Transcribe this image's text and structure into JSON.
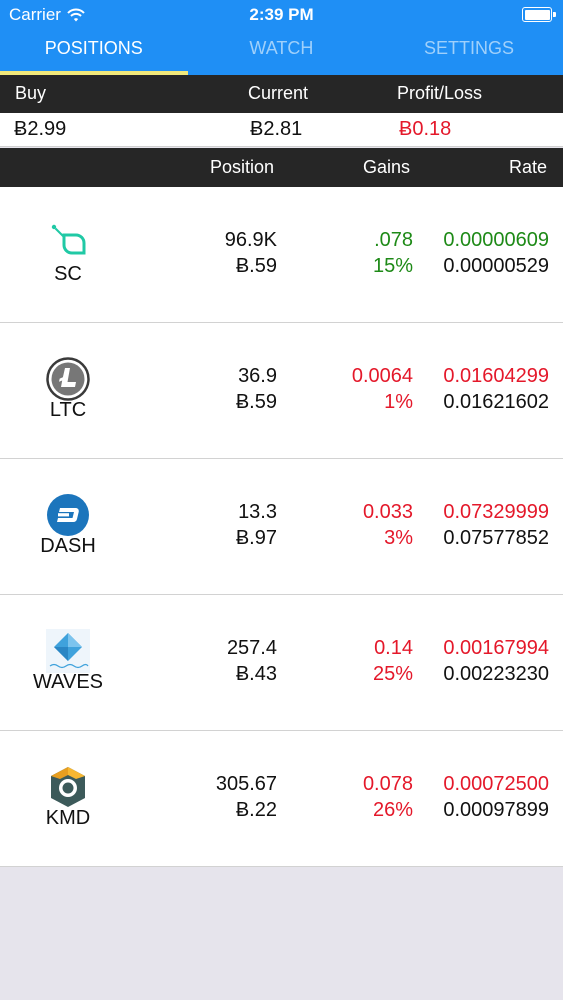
{
  "status_bar": {
    "carrier": "Carrier",
    "time": "2:39 PM",
    "wifi_icon": "wifi-icon",
    "battery_icon": "battery-icon"
  },
  "tabs": [
    {
      "label": "POSITIONS",
      "active": true
    },
    {
      "label": "WATCH",
      "active": false
    },
    {
      "label": "SETTINGS",
      "active": false
    }
  ],
  "summary": {
    "headers": {
      "buy": "Buy",
      "current": "Current",
      "profit_loss": "Profit/Loss"
    },
    "values": {
      "buy": "Ƀ2.99",
      "current": "Ƀ2.81",
      "profit_loss": "Ƀ0.18"
    }
  },
  "list_headers": {
    "position": "Position",
    "gains": "Gains",
    "rate": "Rate"
  },
  "colors": {
    "header_blue": "#1f8ff5",
    "tab_indicator": "#f1e87a",
    "gain": "#1e8a17",
    "loss": "#e4182a"
  },
  "coins": [
    {
      "symbol": "SC",
      "icon": "siacoin-icon",
      "position": "96.9K",
      "cost": "Ƀ.59",
      "gain": ".078",
      "gain_pct": "15%",
      "rate_current": "0.00000609",
      "rate_buy": "0.00000529",
      "trend": "gain"
    },
    {
      "symbol": "LTC",
      "icon": "litecoin-icon",
      "position": "36.9",
      "cost": "Ƀ.59",
      "gain": "0.0064",
      "gain_pct": "1%",
      "rate_current": "0.01604299",
      "rate_buy": "0.01621602",
      "trend": "loss"
    },
    {
      "symbol": "DASH",
      "icon": "dash-icon",
      "position": "13.3",
      "cost": "Ƀ.97",
      "gain": "0.033",
      "gain_pct": "3%",
      "rate_current": "0.07329999",
      "rate_buy": "0.07577852",
      "trend": "loss"
    },
    {
      "symbol": "WAVES",
      "icon": "waves-icon",
      "position": "257.4",
      "cost": "Ƀ.43",
      "gain": "0.14",
      "gain_pct": "25%",
      "rate_current": "0.00167994",
      "rate_buy": "0.00223230",
      "trend": "loss"
    },
    {
      "symbol": "KMD",
      "icon": "komodo-icon",
      "position": "305.67",
      "cost": "Ƀ.22",
      "gain": "0.078",
      "gain_pct": "26%",
      "rate_current": "0.00072500",
      "rate_buy": "0.00097899",
      "trend": "loss"
    }
  ]
}
